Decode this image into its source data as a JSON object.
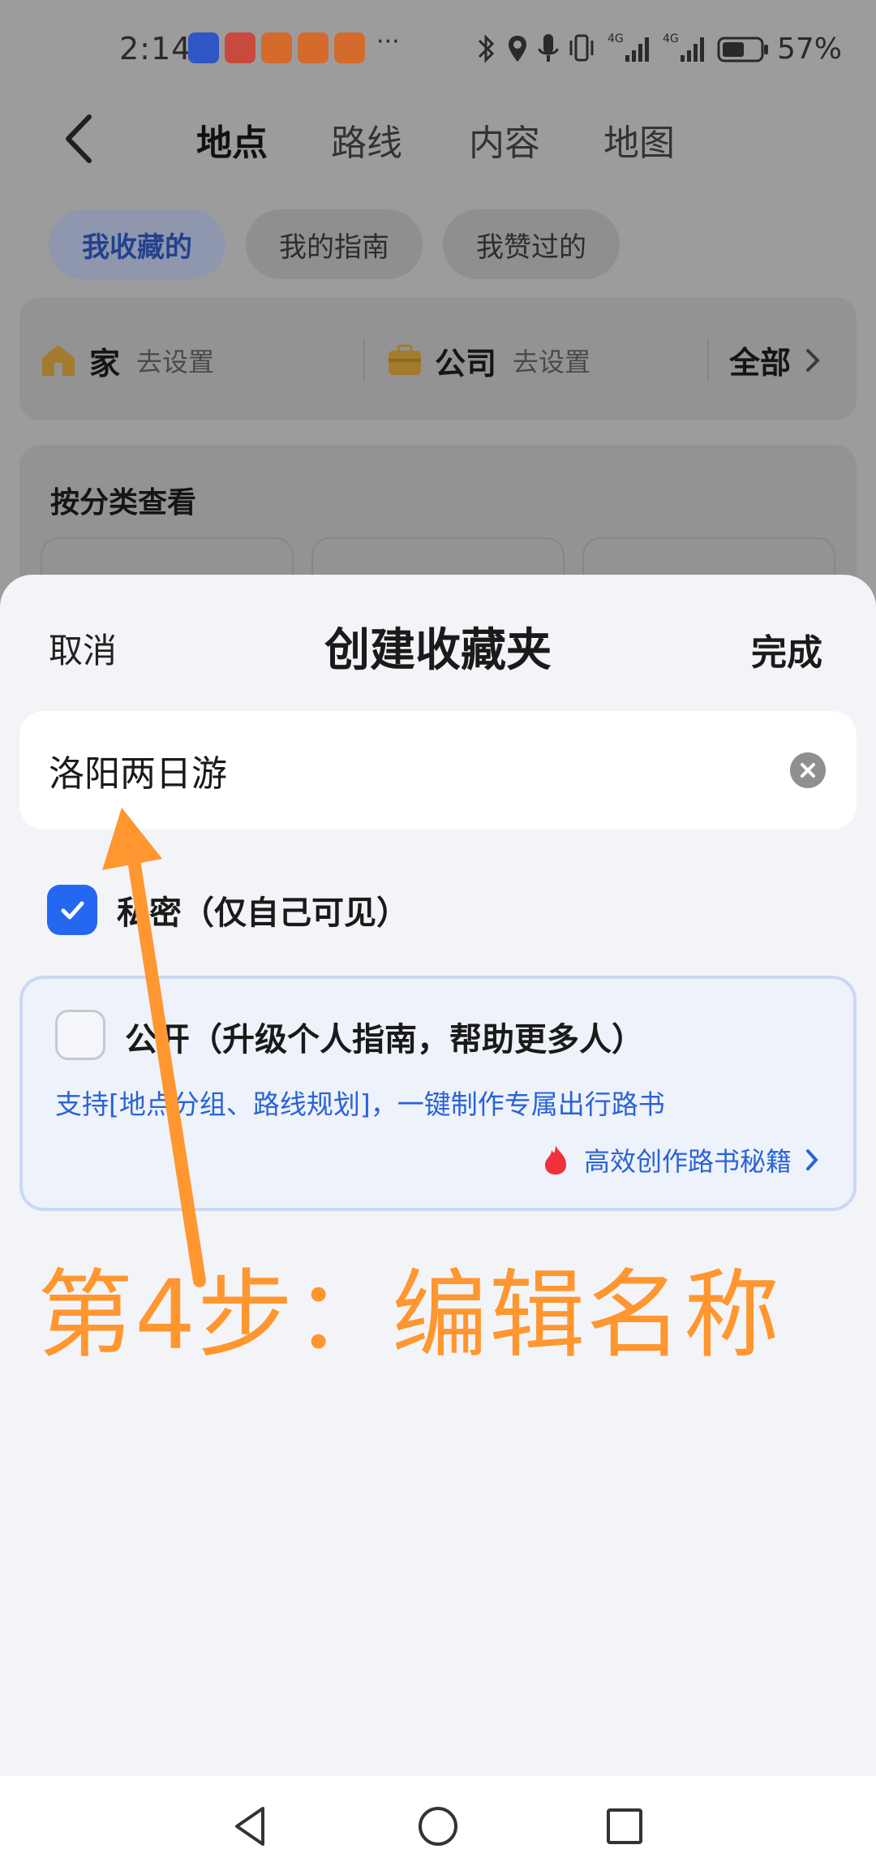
{
  "status_bar": {
    "time": "2:14",
    "battery": "57%",
    "more": "···",
    "network_1": "4G",
    "network_2": "4G"
  },
  "top_nav": {
    "tabs": [
      {
        "label": "地点",
        "active": true
      },
      {
        "label": "路线",
        "active": false
      },
      {
        "label": "内容",
        "active": false
      },
      {
        "label": "地图",
        "active": false
      }
    ]
  },
  "chips": [
    {
      "label": "我收藏的",
      "active": true
    },
    {
      "label": "我的指南",
      "active": false
    },
    {
      "label": "我赞过的",
      "active": false
    }
  ],
  "quick": {
    "home": {
      "label": "家",
      "sub": "去设置"
    },
    "work": {
      "label": "公司",
      "sub": "去设置"
    },
    "all": "全部"
  },
  "category": {
    "title": "按分类查看"
  },
  "sheet": {
    "cancel": "取消",
    "title": "创建收藏夹",
    "done": "完成",
    "name_value": "洛阳两日游",
    "private_label": "私密（仅自己可见）",
    "private_checked": true,
    "public_label": "公开（升级个人指南，帮助更多人）",
    "public_checked": false,
    "public_desc": "支持[地点分组、路线规划]，一键制作专属出行路书",
    "public_link": "高效创作路书秘籍"
  },
  "annotation": {
    "caption": "第4步：编辑名称"
  },
  "colors": {
    "accent_blue": "#2468f2",
    "link_blue": "#2a63d6",
    "annotation_orange": "#ff962f"
  }
}
